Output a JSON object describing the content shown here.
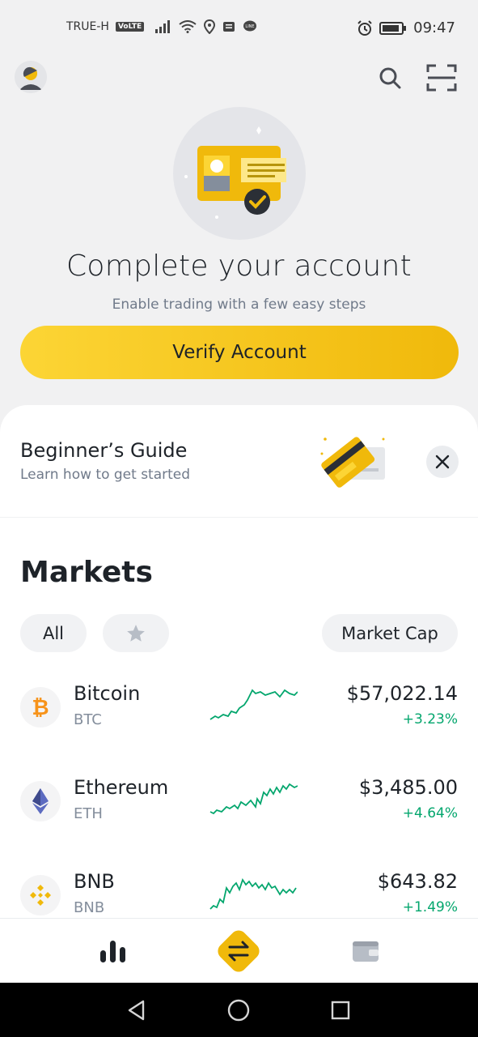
{
  "status_bar": {
    "carrier": "TRUE-H",
    "volte": "VoLTE",
    "time": "09:47"
  },
  "hero": {
    "title": "Complete your account",
    "subtitle": "Enable trading with a few easy steps",
    "verify_label": "Verify Account"
  },
  "guide": {
    "title": "Beginner’s Guide",
    "subtitle": "Learn how to get started"
  },
  "markets": {
    "title": "Markets",
    "filter_all": "All",
    "filter_favorites_icon": "star-icon",
    "sort_label": "Market Cap",
    "items": [
      {
        "name": "Bitcoin",
        "symbol": "BTC",
        "price": "$57,022.14",
        "change": "+3.23%",
        "icon": "bitcoin-icon",
        "icon_color": "#f7931a"
      },
      {
        "name": "Ethereum",
        "symbol": "ETH",
        "price": "$3,485.00",
        "change": "+4.64%",
        "icon": "ethereum-icon",
        "icon_color": "#5c6bc0"
      },
      {
        "name": "BNB",
        "symbol": "BNB",
        "price": "$643.82",
        "change": "+1.49%",
        "icon": "bnb-icon",
        "icon_color": "#f0b90b"
      }
    ]
  },
  "bottom_nav": {
    "items": [
      {
        "icon": "markets-bar-chart-icon"
      },
      {
        "icon": "trade-swap-icon"
      },
      {
        "icon": "wallet-icon"
      }
    ]
  },
  "colors": {
    "brand_yellow": "#f0b90b",
    "positive": "#03a66d",
    "text_primary": "#1e2329",
    "text_secondary": "#707a8a"
  }
}
